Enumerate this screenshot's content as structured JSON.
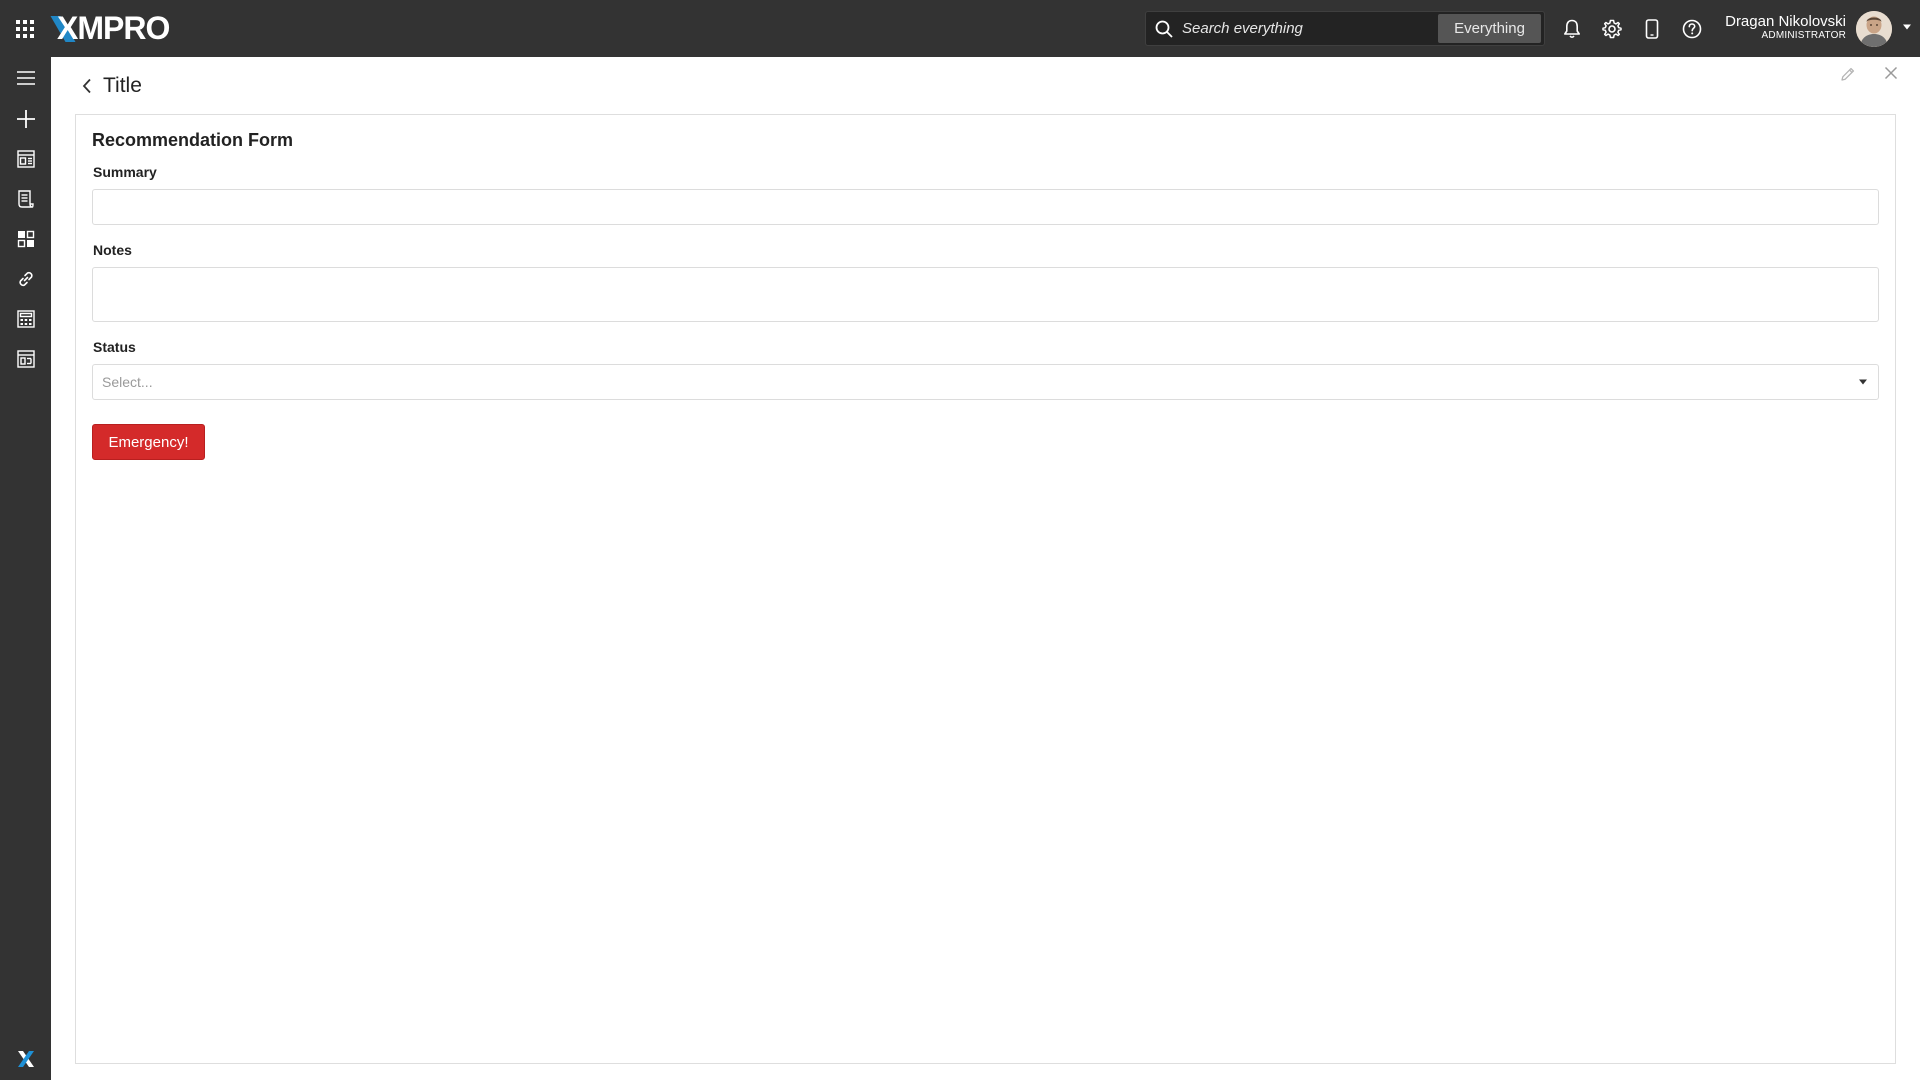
{
  "app": {
    "brand": "XMPRO",
    "brand_accent_color": "#1e90d6"
  },
  "topbar": {
    "apps_icon": "grid-apps-icon",
    "search": {
      "placeholder": "Search everything",
      "value": "",
      "scope_label": "Everything"
    },
    "icons": [
      "bell-icon",
      "gear-icon",
      "mobile-device-icon",
      "help-icon"
    ],
    "user": {
      "name": "Dragan Nikolovski",
      "role": "ADMINISTRATOR"
    }
  },
  "sidebar": {
    "items": [
      {
        "icon": "menu-icon"
      },
      {
        "icon": "plus-icon"
      },
      {
        "icon": "dashboard-icon"
      },
      {
        "icon": "document-list-icon"
      },
      {
        "icon": "widgets-icon"
      },
      {
        "icon": "link-icon"
      },
      {
        "icon": "calculator-app-icon"
      },
      {
        "icon": "calendar-app-icon"
      }
    ],
    "footer_logo": "xmpro-x-logo"
  },
  "page": {
    "title": "Title"
  },
  "form": {
    "title": "Recommendation Form",
    "summary": {
      "label": "Summary",
      "value": ""
    },
    "notes": {
      "label": "Notes",
      "value": ""
    },
    "status": {
      "label": "Status",
      "placeholder": "Select..."
    },
    "emergency_button": {
      "label": "Emergency!",
      "color": "#d42a2a"
    }
  }
}
